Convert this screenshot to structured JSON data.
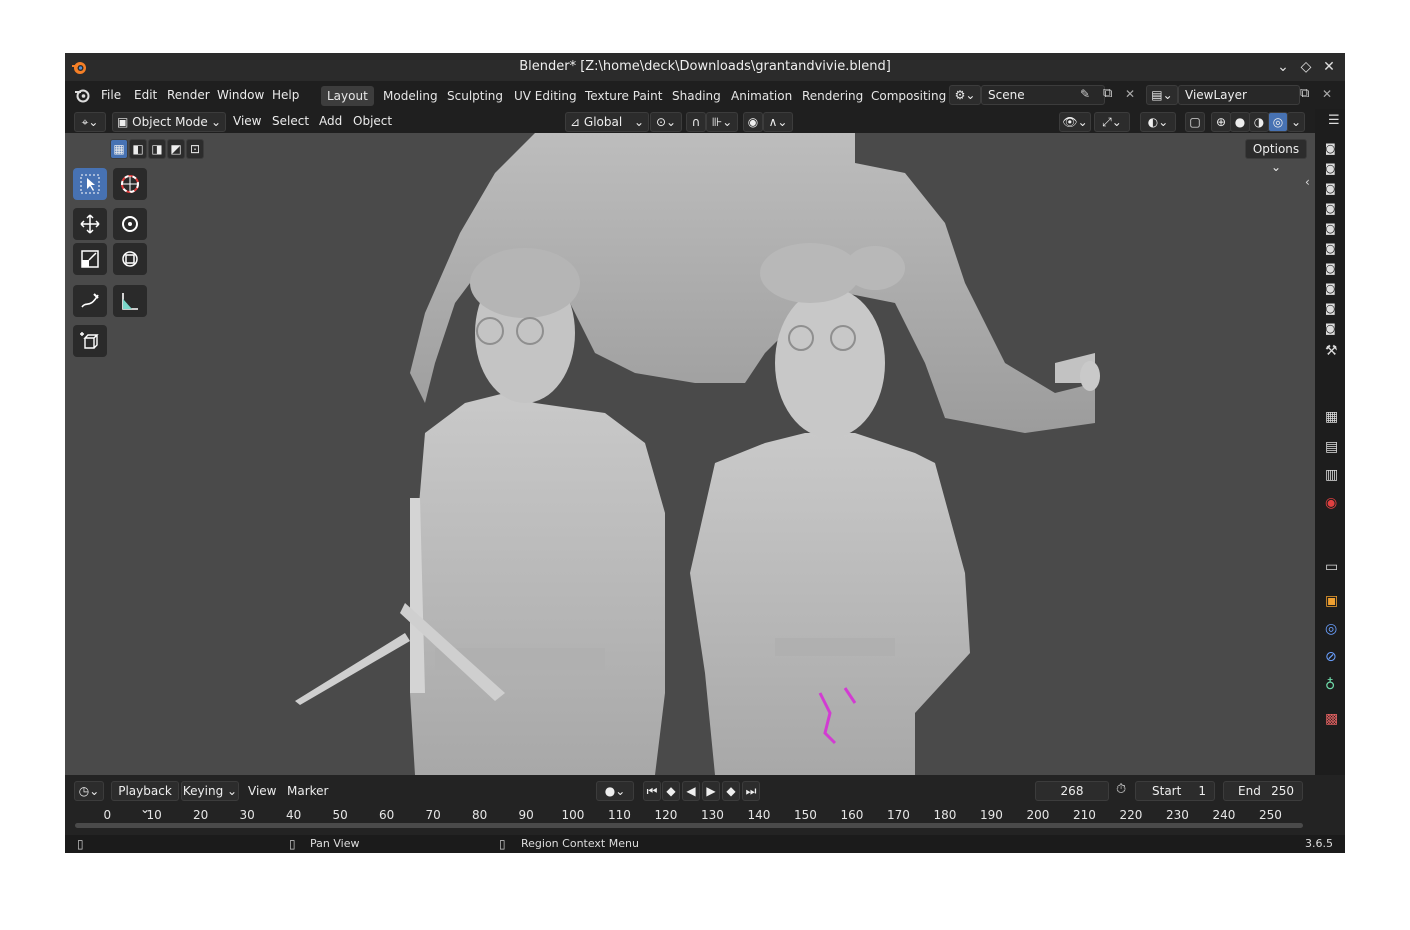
{
  "window": {
    "title": "Blender* [Z:\\home\\deck\\Downloads\\grantandvivie.blend]"
  },
  "menu": [
    "File",
    "Edit",
    "Render",
    "Window",
    "Help"
  ],
  "workspaces": [
    "Layout",
    "Modeling",
    "Sculpting",
    "UV Editing",
    "Texture Paint",
    "Shading",
    "Animation",
    "Rendering",
    "Compositing"
  ],
  "scene": {
    "name": "Scene"
  },
  "view_layer": {
    "name": "ViewLayer"
  },
  "header": {
    "mode": "Object Mode",
    "menus": [
      "View",
      "Select",
      "Add",
      "Object"
    ],
    "orientation": "Global",
    "options": "Options"
  },
  "timeline": {
    "menus": [
      "Playback",
      "Keying",
      "View",
      "Marker"
    ],
    "current_frame": "268",
    "start_label": "Start",
    "start": "1",
    "end_label": "End",
    "end": "250",
    "ticks": [
      "0",
      "10",
      "20",
      "30",
      "40",
      "50",
      "60",
      "70",
      "80",
      "90",
      "100",
      "110",
      "120",
      "130",
      "140",
      "150",
      "160",
      "170",
      "180",
      "190",
      "200",
      "210",
      "220",
      "230",
      "240",
      "250"
    ]
  },
  "status": {
    "pan": "Pan View",
    "context": "Region Context Menu",
    "version": "3.6.5"
  },
  "colors": {
    "accent": "#4772b3",
    "viewport": "#4a4a4a"
  }
}
